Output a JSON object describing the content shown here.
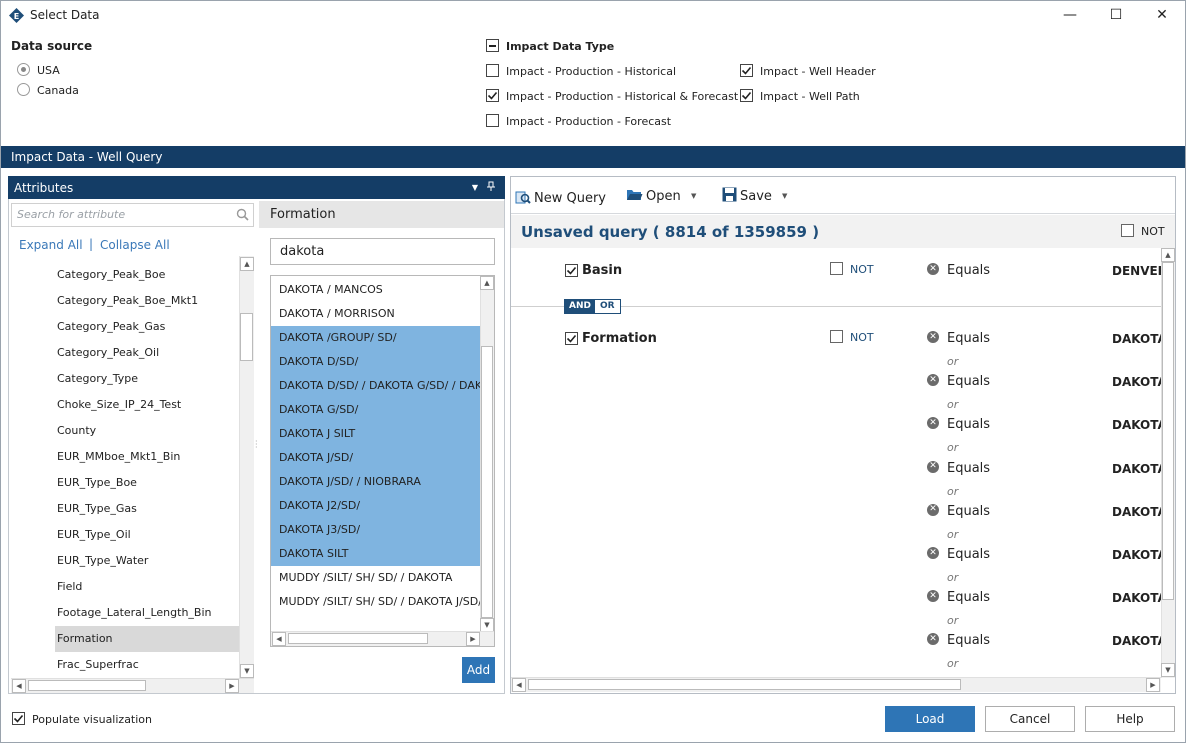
{
  "window": {
    "title": "Select Data",
    "min_glyph": "—",
    "max_glyph": "☐",
    "close_glyph": "✕"
  },
  "data_source": {
    "label": "Data source",
    "options": [
      {
        "label": "USA",
        "selected": true
      },
      {
        "label": "Canada",
        "selected": false
      }
    ]
  },
  "impact_types": {
    "label": "Impact Data Type",
    "items": [
      {
        "label": "Impact - Production - Historical",
        "checked": false
      },
      {
        "label": "Impact - Production - Historical & Forecast",
        "checked": true
      },
      {
        "label": "Impact - Production - Forecast",
        "checked": false
      },
      {
        "label": "Impact - Well Header",
        "checked": true
      },
      {
        "label": "Impact - Well Path",
        "checked": true
      }
    ]
  },
  "section_title": "Impact Data - Well Query",
  "attributes": {
    "title": "Attributes",
    "search_placeholder": "Search for attribute",
    "expand_all": "Expand All",
    "separator": "|",
    "collapse_all": "Collapse All",
    "items": [
      "Category_Peak_Boe",
      "Category_Peak_Boe_Mkt1",
      "Category_Peak_Gas",
      "Category_Peak_Oil",
      "Category_Type",
      "Choke_Size_IP_24_Test",
      "County",
      "EUR_MMboe_Mkt1_Bin",
      "EUR_Type_Boe",
      "EUR_Type_Gas",
      "EUR_Type_Oil",
      "EUR_Type_Water",
      "Field",
      "Footage_Lateral_Length_Bin",
      "Formation",
      "Frac_Superfrac"
    ],
    "selected": "Formation"
  },
  "formation": {
    "title": "Formation",
    "filter_value": "dakota",
    "items": [
      {
        "label": "DAKOTA / MANCOS",
        "selected": false
      },
      {
        "label": "DAKOTA / MORRISON",
        "selected": false
      },
      {
        "label": "DAKOTA /GROUP/ SD/",
        "selected": true
      },
      {
        "label": "DAKOTA D/SD/",
        "selected": true
      },
      {
        "label": "DAKOTA D/SD/ / DAKOTA G/SD/ / DAKOTA",
        "selected": true
      },
      {
        "label": "DAKOTA G/SD/",
        "selected": true
      },
      {
        "label": "DAKOTA J SILT",
        "selected": true
      },
      {
        "label": "DAKOTA J/SD/",
        "selected": true
      },
      {
        "label": "DAKOTA J/SD/ / NIOBRARA",
        "selected": true
      },
      {
        "label": "DAKOTA J2/SD/",
        "selected": true
      },
      {
        "label": "DAKOTA J3/SD/",
        "selected": true
      },
      {
        "label": "DAKOTA SILT",
        "selected": true
      },
      {
        "label": "MUDDY /SILT/ SH/ SD/ / DAKOTA",
        "selected": false
      },
      {
        "label": "MUDDY /SILT/ SH/ SD/ / DAKOTA J/SD/",
        "selected": false
      }
    ],
    "add_label": "Add"
  },
  "query": {
    "toolbar": {
      "new_label": "New Query",
      "open_label": "Open",
      "save_label": "Save"
    },
    "title": "Unsaved query ( 8814 of 1359859 )",
    "not_label": "NOT",
    "and_label": "AND",
    "or_label": "OR",
    "criteria": [
      {
        "label": "Basin",
        "not_label": "NOT",
        "operator": "Equals",
        "value": "DENVER"
      },
      {
        "label": "Formation",
        "not_label": "NOT",
        "operator": "Equals",
        "value": "DAKOTA"
      }
    ],
    "formation_conditions": [
      {
        "operator": "Equals",
        "value": "DAKOTA",
        "joiner": "or"
      },
      {
        "operator": "Equals",
        "value": "DAKOTA",
        "joiner": "or"
      },
      {
        "operator": "Equals",
        "value": "DAKOTA",
        "joiner": "or"
      },
      {
        "operator": "Equals",
        "value": "DAKOTA",
        "joiner": "or"
      },
      {
        "operator": "Equals",
        "value": "DAKOTA",
        "joiner": "or"
      },
      {
        "operator": "Equals",
        "value": "DAKOTA",
        "joiner": "or"
      },
      {
        "operator": "Equals",
        "value": "DAKOTA",
        "joiner": "or"
      },
      {
        "operator": "Equals",
        "value": "DAKOTA",
        "joiner": "or"
      }
    ]
  },
  "footer": {
    "populate_label": "Populate visualization",
    "load_label": "Load",
    "cancel_label": "Cancel",
    "help_label": "Help"
  },
  "colors": {
    "header_bar": "#143d66",
    "accent": "#2e75b6",
    "selection": "#7fb4e0",
    "query_title": "#1f4e79"
  }
}
